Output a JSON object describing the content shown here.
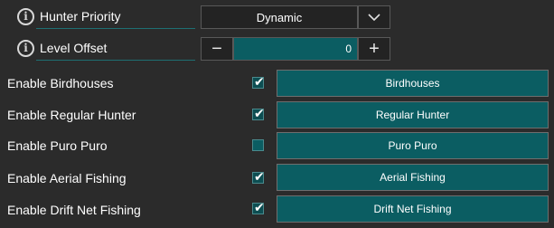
{
  "hunter_priority": {
    "label": "Hunter Priority",
    "value": "Dynamic",
    "info_icon": "info-icon",
    "dropdown_icon": "chevron-down-icon"
  },
  "level_offset": {
    "label": "Level Offset",
    "value": "0",
    "minus_label": "−",
    "plus_label": "+",
    "info_icon": "info-icon"
  },
  "features": [
    {
      "label": "Enable Birdhouses",
      "checked": true,
      "button": "Birdhouses"
    },
    {
      "label": "Enable Regular Hunter",
      "checked": true,
      "button": "Regular Hunter"
    },
    {
      "label": "Enable Puro Puro",
      "checked": false,
      "button": "Puro Puro"
    },
    {
      "label": "Enable Aerial Fishing",
      "checked": true,
      "button": "Aerial Fishing"
    },
    {
      "label": "Enable Drift Net Fishing",
      "checked": true,
      "button": "Drift Net Fishing"
    }
  ],
  "check_glyph": "✔",
  "colors": {
    "background": "#2b2b2b",
    "accent_teal": "#0b5d62",
    "text": "#ffffff"
  }
}
